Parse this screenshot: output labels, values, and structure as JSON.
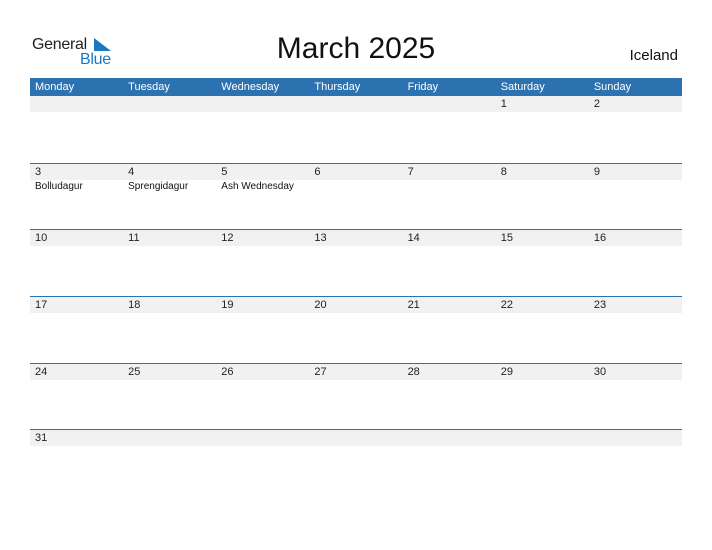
{
  "logo": {
    "part1": "General",
    "part2": "Blue"
  },
  "title": "March 2025",
  "country": "Iceland",
  "colors": {
    "accent": "#2d72b0",
    "logo_blue": "#1a78c2",
    "strip": "#f1f1f1"
  },
  "weekdays": [
    "Monday",
    "Tuesday",
    "Wednesday",
    "Thursday",
    "Friday",
    "Saturday",
    "Sunday"
  ],
  "weeks": [
    {
      "days": [
        "",
        "",
        "",
        "",
        "",
        "1",
        "2"
      ],
      "events": [
        "",
        "",
        "",
        "",
        "",
        "",
        ""
      ]
    },
    {
      "days": [
        "3",
        "4",
        "5",
        "6",
        "7",
        "8",
        "9"
      ],
      "events": [
        "Bolludagur",
        "Sprengidagur",
        "Ash Wednesday",
        "",
        "",
        "",
        ""
      ]
    },
    {
      "days": [
        "10",
        "11",
        "12",
        "13",
        "14",
        "15",
        "16"
      ],
      "events": [
        "",
        "",
        "",
        "",
        "",
        "",
        ""
      ]
    },
    {
      "days": [
        "17",
        "18",
        "19",
        "20",
        "21",
        "22",
        "23"
      ],
      "events": [
        "",
        "",
        "",
        "",
        "",
        "",
        ""
      ]
    },
    {
      "days": [
        "24",
        "25",
        "26",
        "27",
        "28",
        "29",
        "30"
      ],
      "events": [
        "",
        "",
        "",
        "",
        "",
        "",
        ""
      ]
    },
    {
      "days": [
        "31",
        "",
        "",
        "",
        "",
        "",
        ""
      ],
      "events": [
        "",
        "",
        "",
        "",
        "",
        "",
        ""
      ]
    }
  ]
}
